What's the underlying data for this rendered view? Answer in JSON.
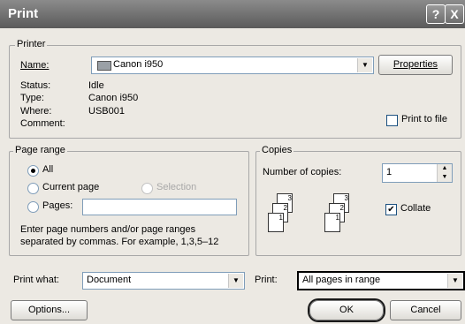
{
  "window": {
    "title": "Print",
    "help_button": "?",
    "close_button": "X"
  },
  "printer": {
    "group_label": "Printer",
    "name_label": "Name:",
    "name_value": "Canon i950",
    "properties_label": "Properties",
    "status_label": "Status:",
    "status_value": "Idle",
    "type_label": "Type:",
    "type_value": "Canon i950",
    "where_label": "Where:",
    "where_value": "USB001",
    "comment_label": "Comment:",
    "comment_value": "",
    "print_to_file_label": "Print to file",
    "print_to_file_checked": false
  },
  "page_range": {
    "group_label": "Page range",
    "all_label": "All",
    "current_page_label": "Current page",
    "selection_label": "Selection",
    "pages_label": "Pages:",
    "pages_value": "",
    "selected": "All",
    "help_text_line1": "Enter page numbers and/or page ranges",
    "help_text_line2": "separated by commas.  For example, 1,3,5–12"
  },
  "copies": {
    "group_label": "Copies",
    "number_label": "Number of copies:",
    "number_value": "1",
    "collate_label": "Collate",
    "collate_checked": true,
    "collate_icons": [
      "3",
      "2",
      "1",
      "3",
      "2",
      "1"
    ]
  },
  "bottom": {
    "print_what_label": "Print what:",
    "print_what_value": "Document",
    "print_label": "Print:",
    "print_value": "All pages in range",
    "options_label": "Options...",
    "ok_label": "OK",
    "cancel_label": "Cancel"
  }
}
